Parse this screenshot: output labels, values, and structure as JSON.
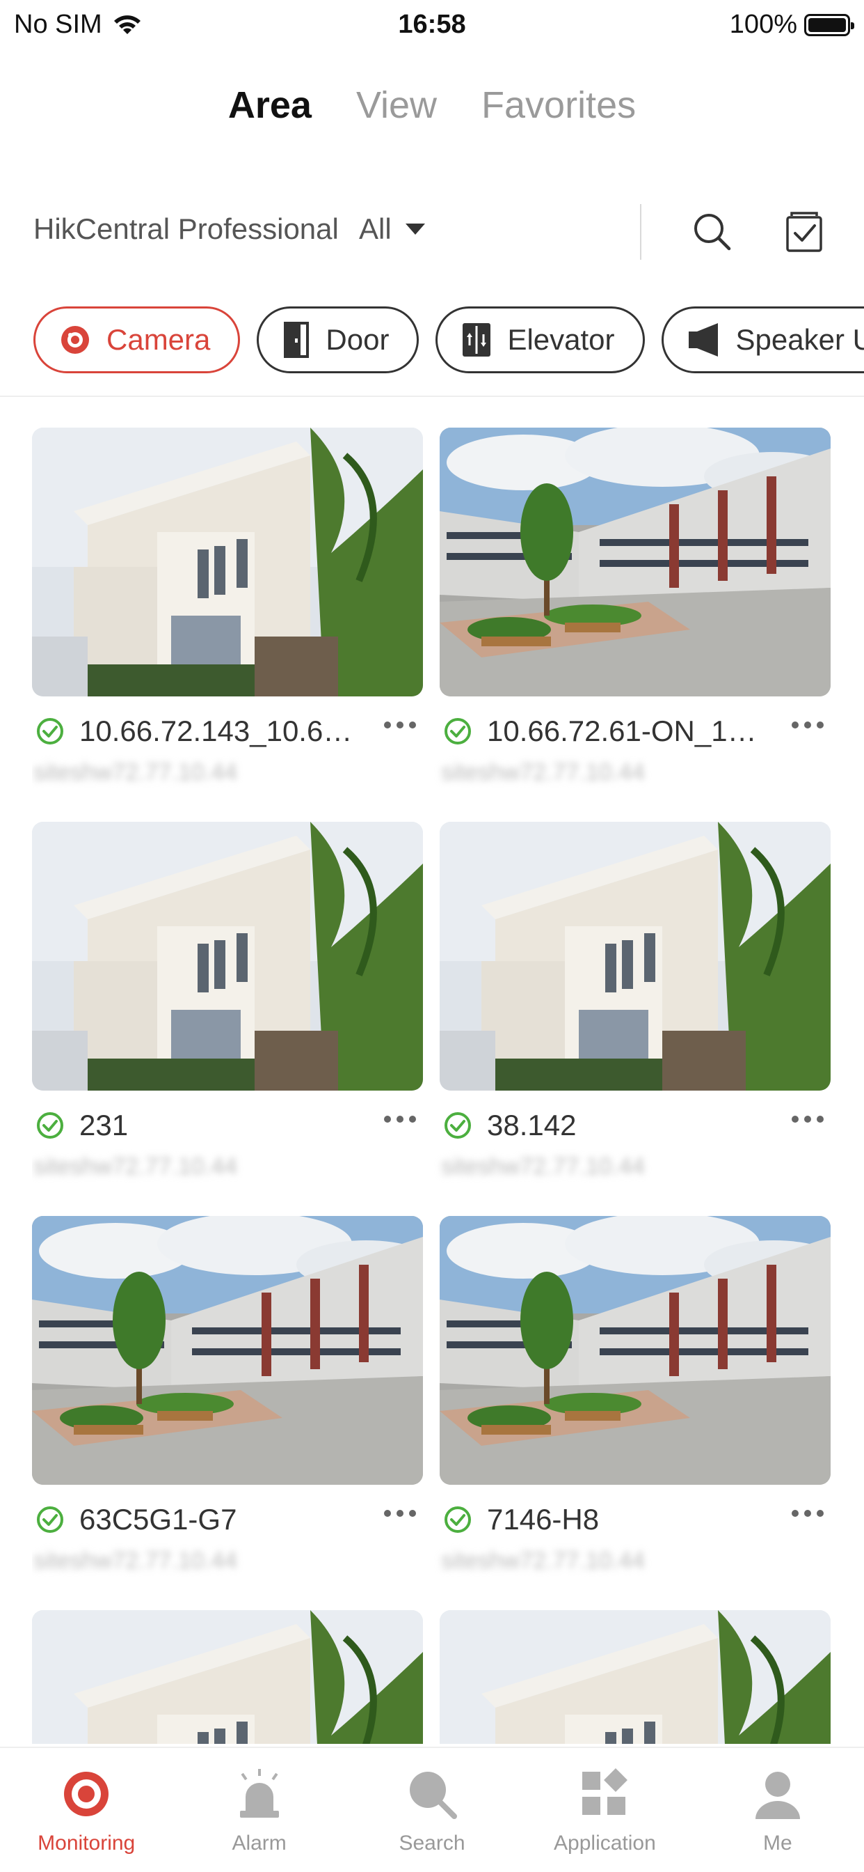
{
  "status_bar": {
    "carrier": "No SIM",
    "time": "16:58",
    "battery": "100%"
  },
  "top_tabs": [
    {
      "label": "Area",
      "active": true
    },
    {
      "label": "View",
      "active": false
    },
    {
      "label": "Favorites",
      "active": false
    }
  ],
  "filter": {
    "site": "HikCentral Professional",
    "scope": "All"
  },
  "categories": [
    {
      "label": "Camera",
      "icon": "camera-icon",
      "active": true
    },
    {
      "label": "Door",
      "icon": "door-icon",
      "active": false
    },
    {
      "label": "Elevator",
      "icon": "elevator-icon",
      "active": false
    },
    {
      "label": "Speaker Un",
      "icon": "speaker-icon",
      "active": false
    }
  ],
  "cameras": [
    {
      "title": "10.66.72.143_10.66.7...",
      "subtitle": "siteshw72.77.10.44",
      "thumbnail": "house",
      "status": "online"
    },
    {
      "title": "10.66.72.61-ON_10.6...",
      "subtitle": "siteshw72.77.10.44",
      "thumbnail": "campus",
      "status": "online"
    },
    {
      "title": "231",
      "subtitle": "siteshw72.77.10.44",
      "thumbnail": "house",
      "status": "online"
    },
    {
      "title": "38.142",
      "subtitle": "siteshw72.77.10.44",
      "thumbnail": "house",
      "status": "online"
    },
    {
      "title": "63C5G1-G7",
      "subtitle": "siteshw72.77.10.44",
      "thumbnail": "campus",
      "status": "online"
    },
    {
      "title": "7146-H8",
      "subtitle": "siteshw72.77.10.44",
      "thumbnail": "campus",
      "status": "online"
    },
    {
      "title": "",
      "subtitle": "",
      "thumbnail": "house",
      "status": "online"
    },
    {
      "title": "",
      "subtitle": "",
      "thumbnail": "house",
      "status": "online"
    }
  ],
  "bottom_nav": [
    {
      "label": "Monitoring",
      "icon": "monitoring-icon",
      "active": true
    },
    {
      "label": "Alarm",
      "icon": "alarm-icon",
      "active": false
    },
    {
      "label": "Search",
      "icon": "search-icon",
      "active": false
    },
    {
      "label": "Application",
      "icon": "application-icon",
      "active": false
    },
    {
      "label": "Me",
      "icon": "me-icon",
      "active": false
    }
  ],
  "colors": {
    "accent": "#d9443a",
    "online": "#4caf3f",
    "inactive": "#9a9a9a"
  }
}
